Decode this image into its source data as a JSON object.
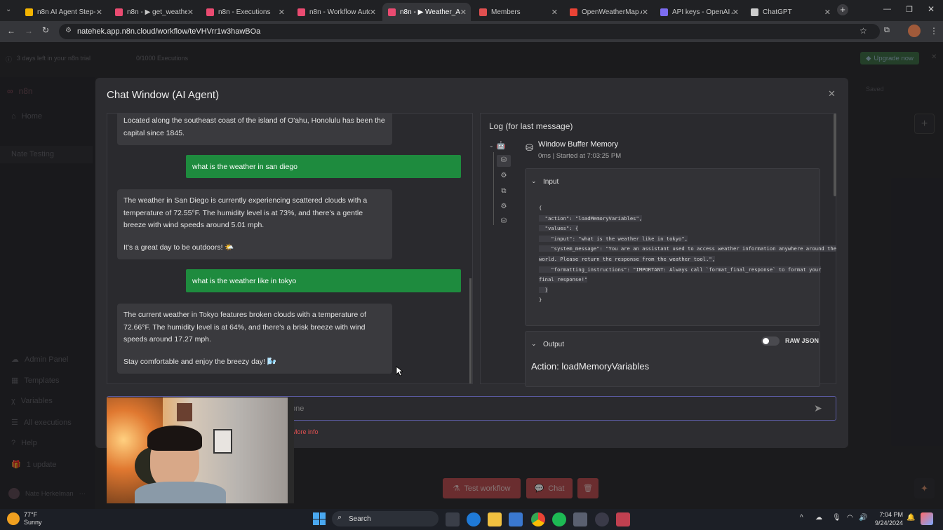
{
  "browser": {
    "tabs": [
      {
        "label": "n8n AI Agent Step-By",
        "color": "#f4b400"
      },
      {
        "label": "n8n - ▶ get_weather",
        "color": "#ea4b71"
      },
      {
        "label": "n8n - Executions",
        "color": "#ea4b71"
      },
      {
        "label": "n8n - Workflow Autom",
        "color": "#ea4b71"
      },
      {
        "label": "n8n - ▶ Weather_Age",
        "color": "#ea4b71"
      },
      {
        "label": "Members",
        "color": "#e05050"
      },
      {
        "label": "OpenWeatherMap AI",
        "color": "#ea4335"
      },
      {
        "label": "API keys - OpenAI AP",
        "color": "#7c6cf0"
      },
      {
        "label": "ChatGPT",
        "color": "#cccccc"
      }
    ],
    "url": "natehek.app.n8n.cloud/workflow/teVHVrr1w3hawBOa"
  },
  "app": {
    "trial_text": "3 days left in your n8n trial",
    "executions_text": "0/1000 Executions",
    "upgrade_label": "Upgrade now",
    "logo": "n8n",
    "saved_label": "Saved",
    "sidebar": {
      "home": "Home",
      "project": "Nate Testing",
      "admin": "Admin Panel",
      "templates": "Templates",
      "variables": "Variables",
      "executions": "All executions",
      "help": "Help",
      "update": "1 update",
      "user": "Nate Herkelman"
    },
    "buttons": {
      "test": "Test workflow",
      "chat": "Chat"
    }
  },
  "modal": {
    "title": "Chat Window (AI Agent)",
    "messages": {
      "m0": "Located along the southeast coast of the island of O'ahu, Honolulu has been the capital since 1845.",
      "u1": "what is the weather in san diego",
      "m1a": "The weather in San Diego is currently experiencing scattered clouds with a temperature of 72.55°F. The humidity level is at 73%, and there's a gentle breeze with wind speeds around 5.01 mph.",
      "m1b": "It's a great day to be outdoors! 🌤️",
      "u2": "what is the weather like in tokyo",
      "m2a": "The current weather in Tokyo features broken clouds with a temperature of 72.66°F. The humidity level is at 64%, and there's a brisk breeze with wind speeds around 17.27 mph.",
      "m2b": "Stay comfortable and enjoy the breezy day! 🌬️"
    },
    "log": {
      "title": "Log (for last message)",
      "node_name": "Window Buffer Memory",
      "node_meta": "0ms | Started at 7:03:25 PM",
      "input_label": "Input",
      "json_lines": [
        "{",
        "  \"action\": \"loadMemoryVariables\",",
        "  \"values\": {",
        "    \"input\": \"what is the weather like in tokyo\",",
        "    \"system_message\": \"You are an assistant used to access weather information anywhere around the",
        "world. Please return the response from the weather tool.\",",
        "    \"formatting_instructions\": \"IMPORTANT: Always call `format_final_response` to format your",
        "final response!\"",
        "  }",
        "}"
      ],
      "output_label": "Output",
      "raw_json_label": "RAW JSON",
      "raw_json_enabled": false,
      "action_text": "Action: loadMemoryVariables"
    },
    "input_placeholder": "one",
    "more_info": "More info"
  },
  "taskbar": {
    "temp": "77°F",
    "weather": "Sunny",
    "search": "Search",
    "time": "7:04 PM",
    "date": "9/24/2024"
  }
}
